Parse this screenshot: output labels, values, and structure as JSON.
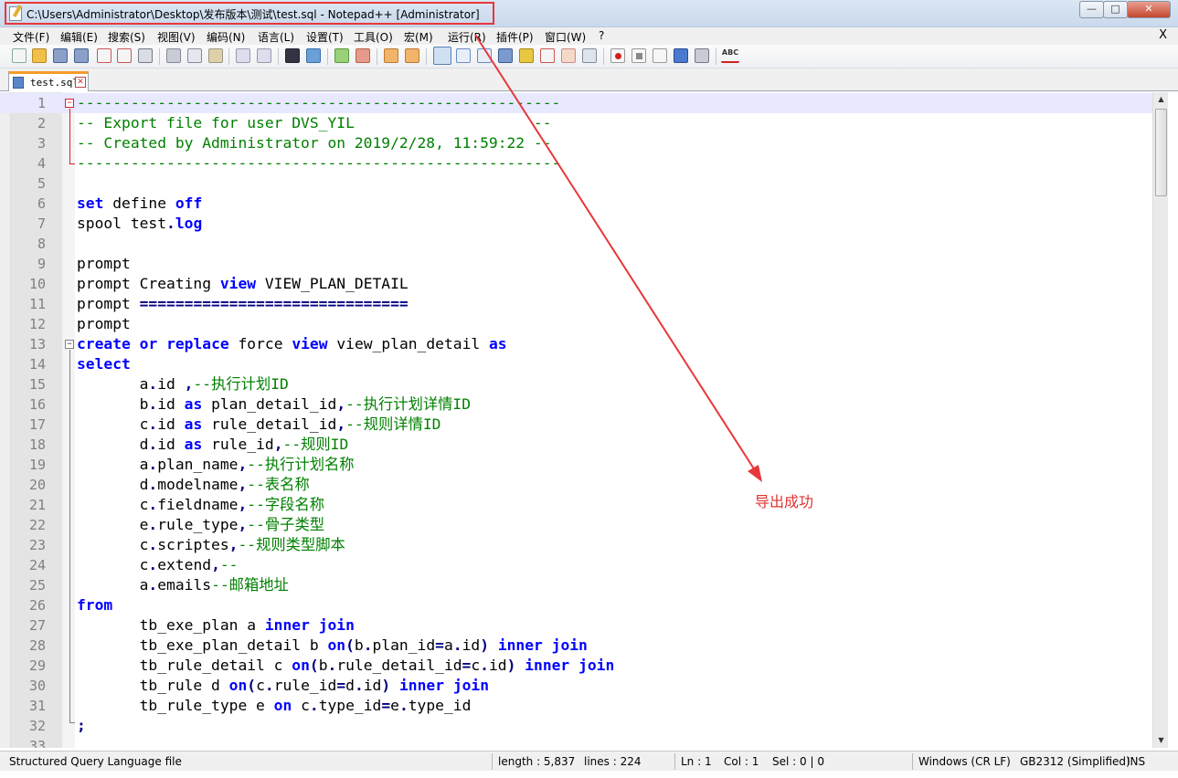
{
  "window": {
    "title": "C:\\Users\\Administrator\\Desktop\\发布版本\\测试\\test.sql - Notepad++ [Administrator]",
    "buttons": {
      "minimize": "—",
      "maximize": "□",
      "close": "✕"
    }
  },
  "menubar": {
    "items": [
      "文件(F)",
      "编辑(E)",
      "搜索(S)",
      "视图(V)",
      "编码(N)",
      "语言(L)",
      "设置(T)",
      "工具(O)",
      "宏(M)",
      "运行(R)",
      "插件(P)",
      "窗口(W)",
      "?"
    ],
    "close_label": "X"
  },
  "toolbar": {
    "icons": [
      "new-file-icon",
      "open-file-icon",
      "save-icon",
      "save-all-icon",
      "close-icon",
      "close-all-icon",
      "print-icon",
      "cut-icon",
      "copy-icon",
      "paste-icon",
      "undo-icon",
      "redo-icon",
      "find-icon",
      "replace-icon",
      "zoom-in-icon",
      "zoom-out-icon",
      "sync-vertical-icon",
      "sync-horizontal-icon",
      "word-wrap-icon",
      "show-all-chars-icon",
      "indent-guide-icon",
      "udl-icon",
      "function-list-icon",
      "folder-workspace-icon",
      "document-map-icon",
      "monitoring-icon",
      "record-macro-icon",
      "stop-record-icon",
      "play-macro-icon",
      "run-macro-multiple-icon",
      "save-macro-icon",
      "spellcheck-icon"
    ],
    "spellcheck_text": "ABC"
  },
  "tab": {
    "label": "test.sql",
    "close": "✕"
  },
  "editor": {
    "lines": [
      {
        "n": "1",
        "t": [
          [
            "cm",
            "------------------------------------------------------"
          ]
        ]
      },
      {
        "n": "2",
        "t": [
          [
            "cm",
            "-- Export file for user DVS_YIL                    --"
          ]
        ]
      },
      {
        "n": "3",
        "t": [
          [
            "cm",
            "-- Created by Administrator on 2019/2/28, 11:59:22 --"
          ]
        ]
      },
      {
        "n": "4",
        "t": [
          [
            "cm",
            "------------------------------------------------------"
          ]
        ]
      },
      {
        "n": "5",
        "t": []
      },
      {
        "n": "6",
        "t": [
          [
            "kw",
            "set"
          ],
          [
            "",
            " define "
          ],
          [
            "kw",
            "off"
          ]
        ]
      },
      {
        "n": "7",
        "t": [
          [
            "",
            "spool test"
          ],
          [
            "op",
            "."
          ],
          [
            "kw",
            "log"
          ]
        ]
      },
      {
        "n": "8",
        "t": []
      },
      {
        "n": "9",
        "t": [
          [
            "",
            "prompt"
          ]
        ]
      },
      {
        "n": "10",
        "t": [
          [
            "",
            "prompt Creating "
          ],
          [
            "kw",
            "view"
          ],
          [
            "",
            " VIEW_PLAN_DETAIL"
          ]
        ]
      },
      {
        "n": "11",
        "t": [
          [
            "",
            "prompt "
          ],
          [
            "op",
            "=============================="
          ]
        ]
      },
      {
        "n": "12",
        "t": [
          [
            "",
            "prompt"
          ]
        ]
      },
      {
        "n": "13",
        "t": [
          [
            "kw",
            "create"
          ],
          [
            "",
            " "
          ],
          [
            "kw",
            "or"
          ],
          [
            "",
            " "
          ],
          [
            "kw",
            "replace"
          ],
          [
            "",
            " force "
          ],
          [
            "kw",
            "view"
          ],
          [
            "",
            " view_plan_detail "
          ],
          [
            "kw",
            "as"
          ]
        ]
      },
      {
        "n": "14",
        "t": [
          [
            "kw",
            "select"
          ]
        ]
      },
      {
        "n": "15",
        "t": [
          [
            "",
            "       a"
          ],
          [
            "op",
            "."
          ],
          [
            "",
            "id "
          ],
          [
            "op",
            ","
          ],
          [
            "cm",
            "--执行计划ID"
          ]
        ]
      },
      {
        "n": "16",
        "t": [
          [
            "",
            "       b"
          ],
          [
            "op",
            "."
          ],
          [
            "",
            "id "
          ],
          [
            "kw",
            "as"
          ],
          [
            "",
            " plan_detail_id"
          ],
          [
            "op",
            ","
          ],
          [
            "cm",
            "--执行计划详情ID"
          ]
        ]
      },
      {
        "n": "17",
        "t": [
          [
            "",
            "       c"
          ],
          [
            "op",
            "."
          ],
          [
            "",
            "id "
          ],
          [
            "kw",
            "as"
          ],
          [
            "",
            " rule_detail_id"
          ],
          [
            "op",
            ","
          ],
          [
            "cm",
            "--规则详情ID"
          ]
        ]
      },
      {
        "n": "18",
        "t": [
          [
            "",
            "       d"
          ],
          [
            "op",
            "."
          ],
          [
            "",
            "id "
          ],
          [
            "kw",
            "as"
          ],
          [
            "",
            " rule_id"
          ],
          [
            "op",
            ","
          ],
          [
            "cm",
            "--规则ID"
          ]
        ]
      },
      {
        "n": "19",
        "t": [
          [
            "",
            "       a"
          ],
          [
            "op",
            "."
          ],
          [
            "",
            "plan_name"
          ],
          [
            "op",
            ","
          ],
          [
            "cm",
            "--执行计划名称"
          ]
        ]
      },
      {
        "n": "20",
        "t": [
          [
            "",
            "       d"
          ],
          [
            "op",
            "."
          ],
          [
            "",
            "modelname"
          ],
          [
            "op",
            ","
          ],
          [
            "cm",
            "--表名称"
          ]
        ]
      },
      {
        "n": "21",
        "t": [
          [
            "",
            "       c"
          ],
          [
            "op",
            "."
          ],
          [
            "",
            "fieldname"
          ],
          [
            "op",
            ","
          ],
          [
            "cm",
            "--字段名称"
          ]
        ]
      },
      {
        "n": "22",
        "t": [
          [
            "",
            "       e"
          ],
          [
            "op",
            "."
          ],
          [
            "",
            "rule_type"
          ],
          [
            "op",
            ","
          ],
          [
            "cm",
            "--骨子类型"
          ]
        ]
      },
      {
        "n": "23",
        "t": [
          [
            "",
            "       c"
          ],
          [
            "op",
            "."
          ],
          [
            "",
            "scriptes"
          ],
          [
            "op",
            ","
          ],
          [
            "cm",
            "--规则类型脚本"
          ]
        ]
      },
      {
        "n": "24",
        "t": [
          [
            "",
            "       c"
          ],
          [
            "op",
            "."
          ],
          [
            "",
            "extend"
          ],
          [
            "op",
            ","
          ],
          [
            "cm",
            "--"
          ]
        ]
      },
      {
        "n": "25",
        "t": [
          [
            "",
            "       a"
          ],
          [
            "op",
            "."
          ],
          [
            "",
            "emails"
          ],
          [
            "cm",
            "--邮箱地址"
          ]
        ]
      },
      {
        "n": "26",
        "t": [
          [
            "kw",
            "from"
          ]
        ]
      },
      {
        "n": "27",
        "t": [
          [
            "",
            "       tb_exe_plan a "
          ],
          [
            "kw",
            "inner"
          ],
          [
            "",
            " "
          ],
          [
            "kw",
            "join"
          ]
        ]
      },
      {
        "n": "28",
        "t": [
          [
            "",
            "       tb_exe_plan_detail b "
          ],
          [
            "kw",
            "on"
          ],
          [
            "op",
            "("
          ],
          [
            "",
            "b"
          ],
          [
            "op",
            "."
          ],
          [
            "",
            "plan_id"
          ],
          [
            "op",
            "="
          ],
          [
            "",
            "a"
          ],
          [
            "op",
            "."
          ],
          [
            "",
            "id"
          ],
          [
            "op",
            ")"
          ],
          [
            "",
            " "
          ],
          [
            "kw",
            "inner"
          ],
          [
            "",
            " "
          ],
          [
            "kw",
            "join"
          ]
        ]
      },
      {
        "n": "29",
        "t": [
          [
            "",
            "       tb_rule_detail c "
          ],
          [
            "kw",
            "on"
          ],
          [
            "op",
            "("
          ],
          [
            "",
            "b"
          ],
          [
            "op",
            "."
          ],
          [
            "",
            "rule_detail_id"
          ],
          [
            "op",
            "="
          ],
          [
            "",
            "c"
          ],
          [
            "op",
            "."
          ],
          [
            "",
            "id"
          ],
          [
            "op",
            ")"
          ],
          [
            "",
            " "
          ],
          [
            "kw",
            "inner"
          ],
          [
            "",
            " "
          ],
          [
            "kw",
            "join"
          ]
        ]
      },
      {
        "n": "30",
        "t": [
          [
            "",
            "       tb_rule d "
          ],
          [
            "kw",
            "on"
          ],
          [
            "op",
            "("
          ],
          [
            "",
            "c"
          ],
          [
            "op",
            "."
          ],
          [
            "",
            "rule_id"
          ],
          [
            "op",
            "="
          ],
          [
            "",
            "d"
          ],
          [
            "op",
            "."
          ],
          [
            "",
            "id"
          ],
          [
            "op",
            ")"
          ],
          [
            "",
            " "
          ],
          [
            "kw",
            "inner"
          ],
          [
            "",
            " "
          ],
          [
            "kw",
            "join"
          ]
        ]
      },
      {
        "n": "31",
        "t": [
          [
            "",
            "       tb_rule_type e "
          ],
          [
            "kw",
            "on"
          ],
          [
            "",
            " c"
          ],
          [
            "op",
            "."
          ],
          [
            "",
            "type_id"
          ],
          [
            "op",
            "="
          ],
          [
            "",
            "e"
          ],
          [
            "op",
            "."
          ],
          [
            "",
            "type_id"
          ]
        ]
      },
      {
        "n": "32",
        "t": [
          [
            "op",
            ";"
          ]
        ]
      },
      {
        "n": "33",
        "t": []
      }
    ]
  },
  "statusbar": {
    "file_type": "Structured Query Language file",
    "length": "length : 5,837",
    "lines": "lines : 224",
    "ln": "Ln : 1",
    "col": "Col : 1",
    "sel": "Sel : 0 | 0",
    "eol": "Windows (CR LF)",
    "encoding": "GB2312 (Simplified)",
    "mode": "INS"
  },
  "annotation": {
    "text": "导出成功"
  },
  "colors": {
    "keyword": "#0000ff",
    "comment": "#008000",
    "operator": "#000080",
    "annotation": "#e0332f",
    "tab_accent": "#f59b2b"
  }
}
